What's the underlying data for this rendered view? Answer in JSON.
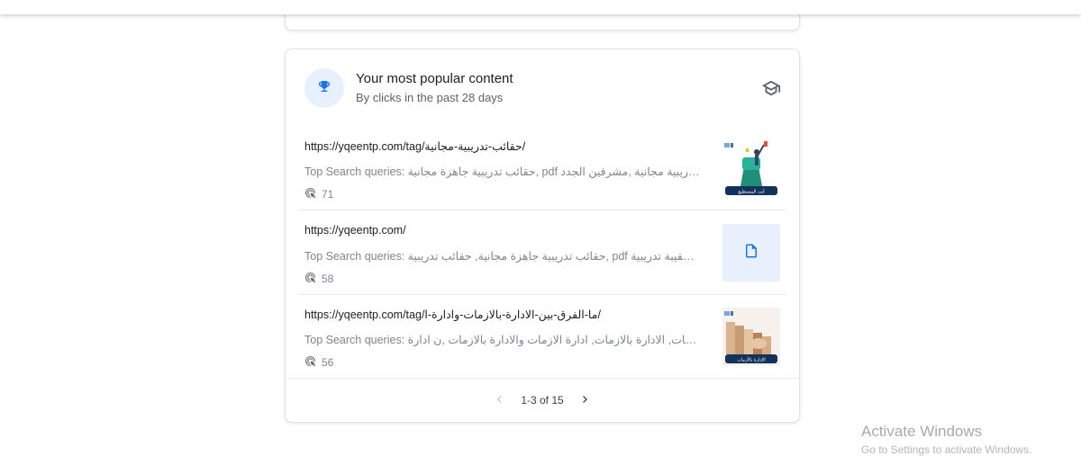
{
  "card": {
    "title": "Your most popular content",
    "subtitle": "By clicks in the past 28 days",
    "icons": {
      "header": "trophy-icon",
      "learn": "school-icon"
    },
    "accent_color": "#1a73e8"
  },
  "rows": [
    {
      "url": "https://yqeentp.com/tag/حقائب-تدريبية-مجانية/",
      "queries": "Top Search queries: حقائب تدريبية جاهزة مجانية, pdf حقائب تدريبية مجانية ,حقيبة تدريبية مجانية ,مشرفين الجدد",
      "clicks": "71",
      "thumb_text": "أنت المستطيع"
    },
    {
      "url": "https://yqeentp.com/",
      "queries": "Top Search queries: حقائب تدريبية جاهزة مجانية, حقائب تدريبية, pdf حقيبة تدريبية جاهزة ,حقيبة تدريبية",
      "clicks": "58"
    },
    {
      "url": "https://yqeentp.com/tag/ما-الفرق-بين-الادارة-بالازمات-وادارة-ا/",
      "queries": "Top Search queries: الإدارة بالأزمات, الادارة بالازمات, ادارة الازمات والادارة بالازمات ,ن ادارة",
      "clicks": "56",
      "thumb_text": "الإدارة بالأزمات"
    }
  ],
  "pagination": {
    "label": "1-3 of 15"
  },
  "watermark": {
    "line1": "Activate Windows",
    "line2": "Go to Settings to activate Windows."
  }
}
